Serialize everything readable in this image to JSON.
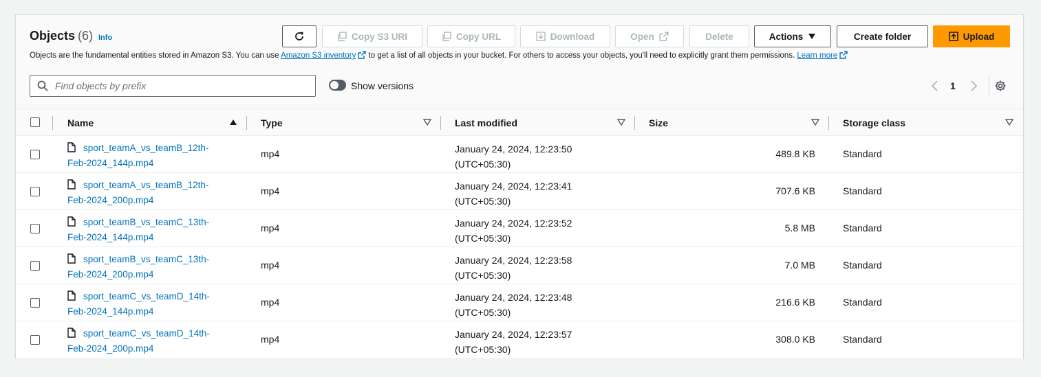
{
  "header": {
    "title": "Objects",
    "count": "(6)",
    "info": "Info",
    "description_pre": "Objects are the fundamental entities stored in Amazon S3. You can use ",
    "inventory_link": "Amazon S3 inventory",
    "description_mid": " to get a list of all objects in your bucket. For others to access your objects, you'll need to explicitly grant them permissions. ",
    "learn_more": "Learn more"
  },
  "toolbar": {
    "copy_s3_uri": "Copy S3 URI",
    "copy_url": "Copy URL",
    "download": "Download",
    "open": "Open",
    "delete": "Delete",
    "actions": "Actions",
    "create_folder": "Create folder",
    "upload": "Upload"
  },
  "search": {
    "placeholder": "Find objects by prefix"
  },
  "versions": {
    "label": "Show versions"
  },
  "pagination": {
    "page": "1"
  },
  "table": {
    "columns": [
      "Name",
      "Type",
      "Last modified",
      "Size",
      "Storage class"
    ],
    "rows": [
      {
        "name1": "sport_teamA_vs_teamB_12th-",
        "name2": "Feb-2024_144p.mp4",
        "type": "mp4",
        "mod1": "January 24, 2024, 12:23:50",
        "mod2": "(UTC+05:30)",
        "size": "489.8 KB",
        "storage": "Standard"
      },
      {
        "name1": "sport_teamA_vs_teamB_12th-",
        "name2": "Feb-2024_200p.mp4",
        "type": "mp4",
        "mod1": "January 24, 2024, 12:23:41",
        "mod2": "(UTC+05:30)",
        "size": "707.6 KB",
        "storage": "Standard"
      },
      {
        "name1": "sport_teamB_vs_teamC_13th-",
        "name2": "Feb-2024_144p.mp4",
        "type": "mp4",
        "mod1": "January 24, 2024, 12:23:52",
        "mod2": "(UTC+05:30)",
        "size": "5.8 MB",
        "storage": "Standard"
      },
      {
        "name1": "sport_teamB_vs_teamC_13th-",
        "name2": "Feb-2024_200p.mp4",
        "type": "mp4",
        "mod1": "January 24, 2024, 12:23:58",
        "mod2": "(UTC+05:30)",
        "size": "7.0 MB",
        "storage": "Standard"
      },
      {
        "name1": "sport_teamC_vs_teamD_14th-",
        "name2": "Feb-2024_144p.mp4",
        "type": "mp4",
        "mod1": "January 24, 2024, 12:23:48",
        "mod2": "(UTC+05:30)",
        "size": "216.6 KB",
        "storage": "Standard"
      },
      {
        "name1": "sport_teamC_vs_teamD_14th-",
        "name2": "Feb-2024_200p.mp4",
        "type": "mp4",
        "mod1": "January 24, 2024, 12:23:57",
        "mod2": "(UTC+05:30)",
        "size": "308.0 KB",
        "storage": "Standard"
      }
    ]
  },
  "colors": {
    "link": "#0073bb",
    "primary": "#ff9900",
    "border": "#545b64",
    "disabled": "#aab7b8"
  }
}
